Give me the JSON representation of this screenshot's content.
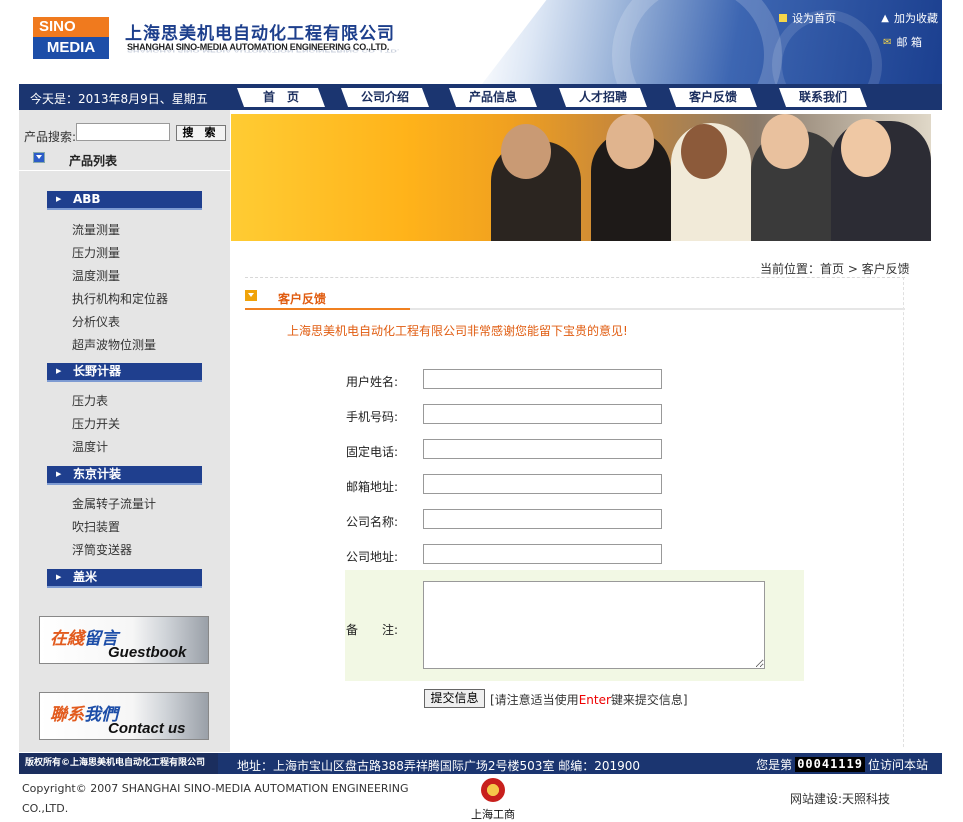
{
  "header": {
    "logo_top": "SINO",
    "logo_bottom": "MEDIA",
    "company_cn": "上海思美机电自动化工程有限公司",
    "company_en": "SHANGHAI SINO-MEDIA AUTOMATION ENGINEERING CO.,LTD.",
    "links": {
      "homepage": "设为首页",
      "favorite": "加为收藏",
      "mailbox": "邮  箱"
    }
  },
  "nav": {
    "date": "今天是：2013年8月9日、星期五",
    "items": [
      "首　页",
      "公司介绍",
      "产品信息",
      "人才招聘",
      "客户反馈",
      "联系我们"
    ]
  },
  "sidebar": {
    "search_label": "产品搜索:",
    "search_value": "",
    "search_button": "搜 索",
    "product_list_title": "产品列表",
    "categories": [
      {
        "name": "ABB",
        "items": [
          "流量测量",
          "压力测量",
          "温度测量",
          "执行机构和定位器",
          "分析仪表",
          "超声波物位测量"
        ]
      },
      {
        "name": "长野计器",
        "items": [
          "压力表",
          "压力开关",
          "温度计"
        ]
      },
      {
        "name": "东京计装",
        "items": [
          "金属转子流量计",
          "吹扫装置",
          "浮筒变送器"
        ]
      },
      {
        "name": "盖米",
        "items": []
      }
    ],
    "guestbook": {
      "cn_a": "在綫",
      "cn_b": "留言",
      "en": "Guestbook"
    },
    "contact": {
      "cn_a": "聯系",
      "cn_b": "我們",
      "en": "Contact us"
    }
  },
  "content": {
    "breadcrumb": "当前位置：首页 > 客户反馈",
    "section_title": "客户反馈",
    "thanks": "上海思美机电自动化工程有限公司非常感谢您能留下宝贵的意见!",
    "form": {
      "name_label": "用户姓名:",
      "mobile_label": "手机号码:",
      "phone_label": "固定电话:",
      "email_label": "邮箱地址:",
      "company_label": "公司名称:",
      "address_label": "公司地址:",
      "note_label": "备　　注:",
      "values": {
        "name": "",
        "mobile": "",
        "phone": "",
        "email": "",
        "company": "",
        "address": "",
        "note": ""
      },
      "submit_label": "提交信息",
      "hint_before": "[请注意适当使用",
      "hint_key": "Enter",
      "hint_after": "键来提交信息]"
    }
  },
  "footer": {
    "copyright_short": "版权所有©上海思美机电自动化工程有限公司",
    "address": "地址：上海市宝山区盘古路388弄祥腾国际广场2号楼503室 邮编：201900",
    "visit_before": "您是第",
    "visit_count": "00041119",
    "visit_after": "位访问本站",
    "copyright_full": "Copyright© 2007 SHANGHAI SINO-MEDIA AUTOMATION ENGINEERING CO.,LTD.",
    "gongshang": "上海工商",
    "credit": "网站建设:天照科技"
  },
  "colors": {
    "navy": "#1b3570",
    "orange": "#e05c10",
    "accent_blue": "#1f3f8e"
  }
}
